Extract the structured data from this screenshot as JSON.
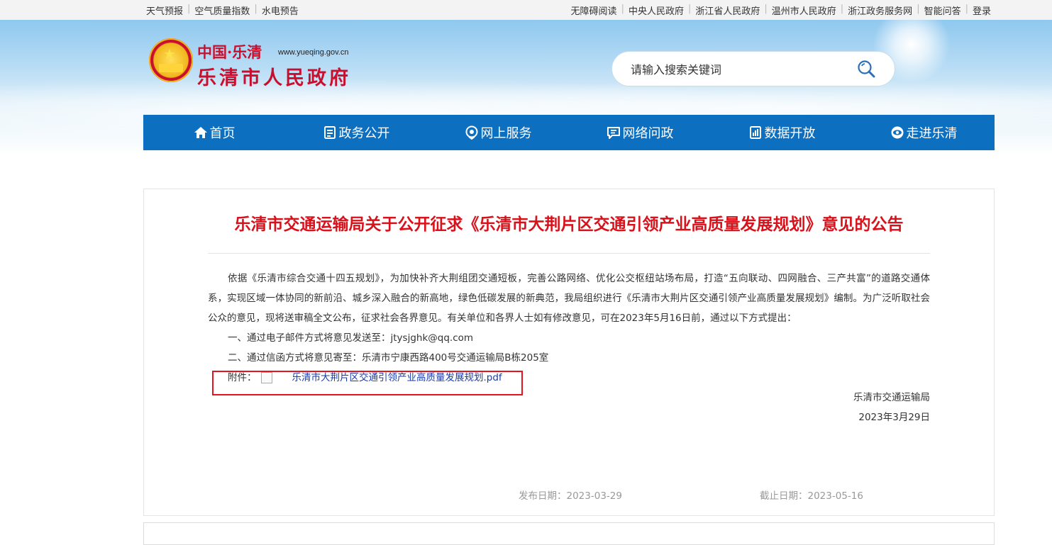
{
  "topbar": {
    "left": [
      "天气预报",
      "空气质量指数",
      "水电预告"
    ],
    "right": [
      "无障碍阅读",
      "中央人民政府",
      "浙江省人民政府",
      "温州市人民政府",
      "浙江政务服务网",
      "智能问答",
      "登录"
    ]
  },
  "header": {
    "logo_top": "中国·乐清",
    "logo_url": "www.yueqing.gov.cn",
    "logo_main": "乐清市人民政府",
    "search_placeholder": "请输入搜索关键词"
  },
  "nav": {
    "items": [
      {
        "label": "首页",
        "icon": "home-icon"
      },
      {
        "label": "政务公开",
        "icon": "document-icon"
      },
      {
        "label": "网上服务",
        "icon": "service-icon"
      },
      {
        "label": "网络问政",
        "icon": "chat-icon"
      },
      {
        "label": "数据开放",
        "icon": "data-icon"
      },
      {
        "label": "走进乐清",
        "icon": "eye-icon"
      }
    ]
  },
  "article": {
    "title": "乐清市交通运输局关于公开征求《乐清市大荆片区交通引领产业高质量发展规划》意见的公告",
    "paragraph": "依据《乐清市综合交通十四五规划》，为加快补齐大荆组团交通短板，完善公路网络、优化公交枢纽站场布局，打造“五向联动、四网融合、三产共富”的道路交通体系，实现区域一体协同的新前沿、城乡深入融合的新高地，绿色低碳发展的新典范，我局组织进行《乐清市大荆片区交通引领产业高质量发展规划》编制。为广泛听取社会公众的意见，现将送审稿全文公布，征求社会各界意见。有关单位和各界人士如有修改意见，可在2023年5月16日前，通过以下方式提出：",
    "method1": "一、通过电子邮件方式将意见发送至：jtysjghk@qq.com",
    "method2": "二、通过信函方式将意见寄至：乐清市宁康西路400号交通运输局B栋205室",
    "attachment_label": "附件：",
    "attachment_link": "乐清市大荆片区交通引领产业高质量发展规划.pdf",
    "signature_org": "乐清市交通运输局",
    "signature_date": "2023年3月29日",
    "publish_date": "发布日期：2023-03-29",
    "deadline_date": "截止日期：2023-05-16"
  },
  "colors": {
    "nav_bg": "#0c6fc0",
    "title_red": "#d8111a",
    "highlight_red": "#e0161f",
    "link_blue": "#1a3ba8"
  }
}
